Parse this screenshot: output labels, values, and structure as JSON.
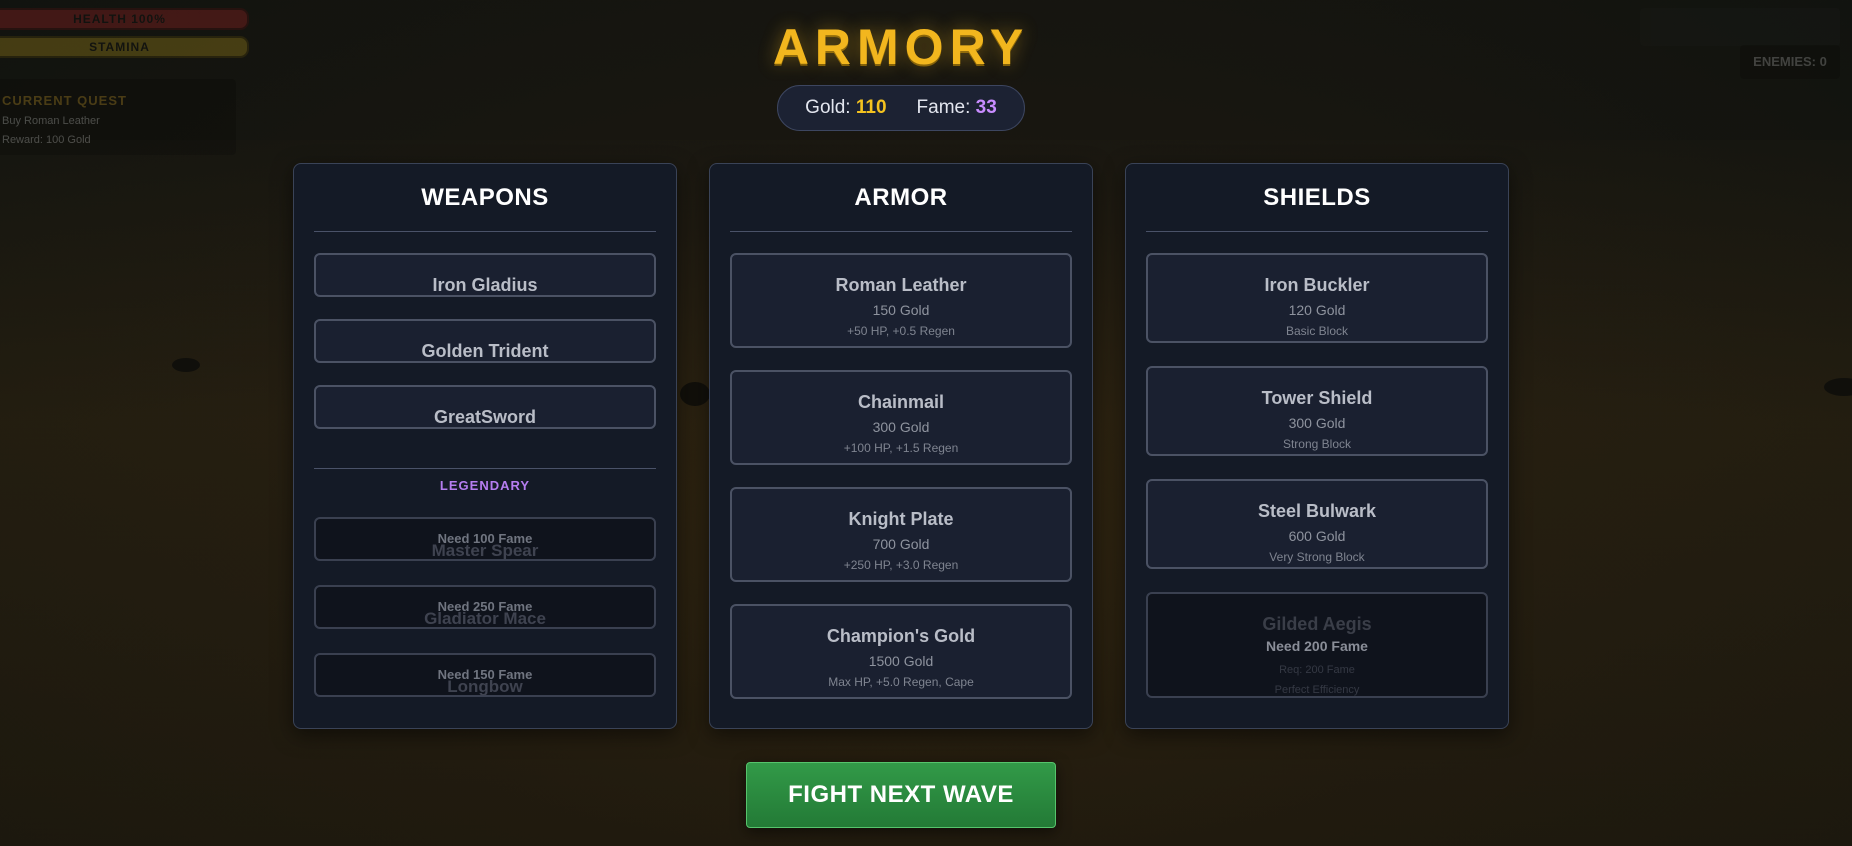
{
  "hud": {
    "health_label": "HEALTH 100%",
    "stamina_label": "STAMINA",
    "quest_title": "CURRENT QUEST",
    "quest_line1": "Buy Roman Leather",
    "quest_line2": "Reward: 100 Gold",
    "enemies_label": "ENEMIES: 0"
  },
  "header": {
    "title": "ARMORY",
    "gold_label": "Gold:",
    "gold_value": "110",
    "fame_label": "Fame:",
    "fame_value": "33"
  },
  "weapons": {
    "title": "WEAPONS",
    "items": [
      {
        "name": "Iron Gladius"
      },
      {
        "name": "Golden Trident"
      },
      {
        "name": "GreatSword"
      }
    ],
    "legendary_label": "LEGENDARY",
    "legendary": [
      {
        "name": "Master Spear",
        "requirement": "Need 100 Fame"
      },
      {
        "name": "Gladiator Mace",
        "requirement": "Need 250 Fame"
      },
      {
        "name": "Longbow",
        "requirement": "Need 150 Fame"
      }
    ]
  },
  "armor": {
    "title": "ARMOR",
    "items": [
      {
        "name": "Roman Leather",
        "price": "150 Gold",
        "stat": "+50 HP, +0.5 Regen"
      },
      {
        "name": "Chainmail",
        "price": "300 Gold",
        "stat": "+100 HP, +1.5 Regen"
      },
      {
        "name": "Knight Plate",
        "price": "700 Gold",
        "stat": "+250 HP, +3.0 Regen"
      },
      {
        "name": "Champion's Gold",
        "price": "1500 Gold",
        "stat": "Max HP, +5.0 Regen, Cape"
      }
    ]
  },
  "shields": {
    "title": "SHIELDS",
    "items": [
      {
        "name": "Iron Buckler",
        "price": "120 Gold",
        "stat": "Basic Block"
      },
      {
        "name": "Tower Shield",
        "price": "300 Gold",
        "stat": "Strong Block"
      },
      {
        "name": "Steel Bulwark",
        "price": "600 Gold",
        "stat": "Very Strong Block"
      }
    ],
    "locked": {
      "name": "Gilded Aegis",
      "requirement": "Need 200 Fame",
      "price": "Req: 200 Fame",
      "stat": "Perfect Efficiency"
    }
  },
  "fight_button": "FIGHT NEXT WAVE",
  "colors": {
    "title": "#f2b61e",
    "gold": "#f4c21f",
    "fame": "#c88cff",
    "legendary": "#b57df0",
    "fight_button": "#2b8a3f"
  }
}
